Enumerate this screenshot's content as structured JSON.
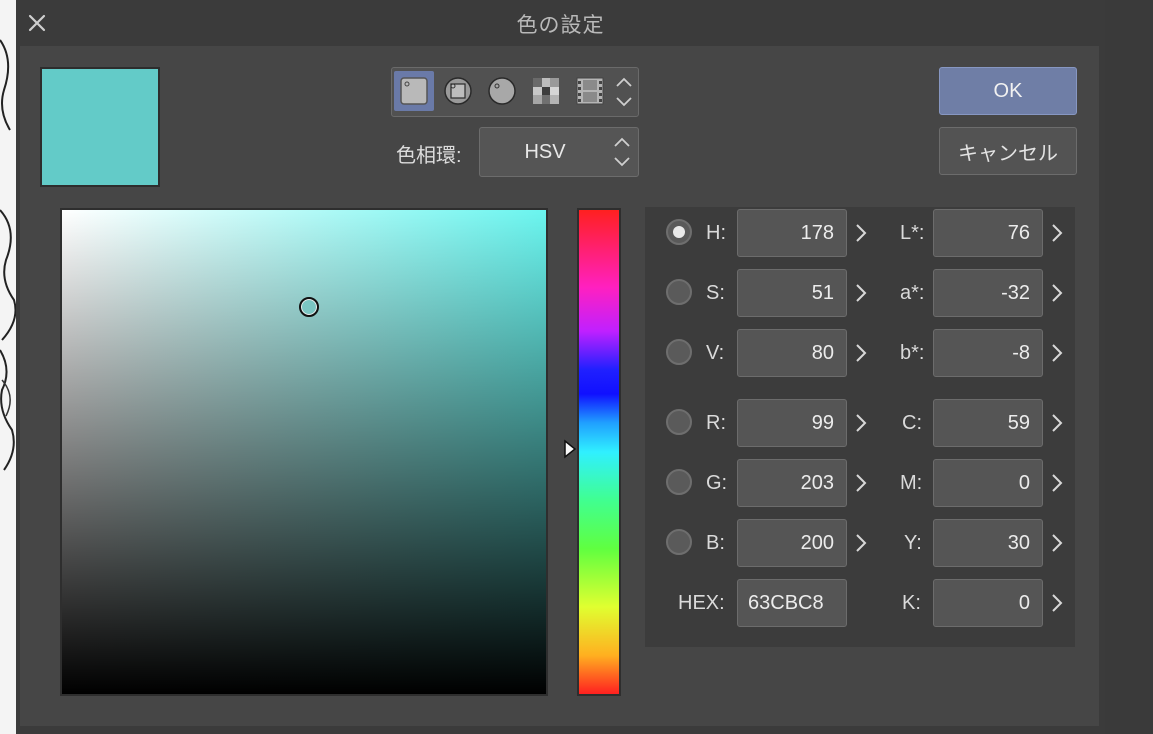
{
  "window": {
    "title": "色の設定"
  },
  "colors": {
    "current_color": "#63CBC8",
    "accent": "#6f7ea6"
  },
  "mode_bar": {
    "buttons": [
      "square-palette-icon",
      "triangle-ring-icon",
      "circle-icon",
      "grid-icon",
      "film-icon"
    ],
    "active_index": 0
  },
  "hue_ring": {
    "label": "色相環:",
    "value": "HSV"
  },
  "buttons": {
    "ok": "OK",
    "cancel": "キャンセル"
  },
  "picker": {
    "saturation": 0.51,
    "value": 0.8,
    "hue_degrees": 178
  },
  "fields": {
    "h": {
      "label": "H:",
      "value": "178"
    },
    "s": {
      "label": "S:",
      "value": "51"
    },
    "v": {
      "label": "V:",
      "value": "80"
    },
    "r": {
      "label": "R:",
      "value": "99"
    },
    "g": {
      "label": "G:",
      "value": "203"
    },
    "b": {
      "label": "B:",
      "value": "200"
    },
    "hex": {
      "label": "HEX:",
      "value": "63CBC8"
    },
    "l_star": {
      "label": "L*:",
      "value": "76"
    },
    "a_star": {
      "label": "a*:",
      "value": "-32"
    },
    "b_star": {
      "label": "b*:",
      "value": "-8"
    },
    "c": {
      "label": "C:",
      "value": "59"
    },
    "m": {
      "label": "M:",
      "value": "0"
    },
    "y": {
      "label": "Y:",
      "value": "30"
    },
    "k": {
      "label": "K:",
      "value": "0"
    }
  },
  "selected_field": "h"
}
